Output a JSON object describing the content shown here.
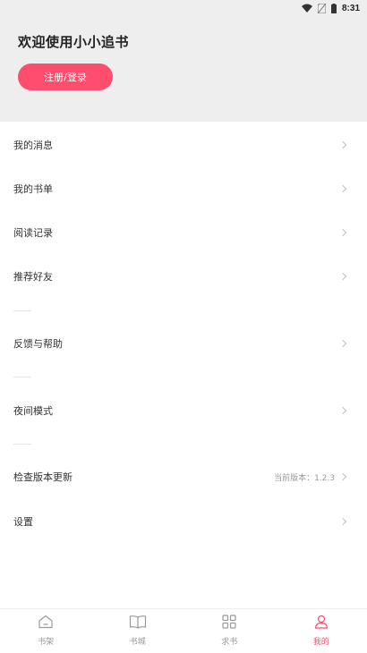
{
  "status_bar": {
    "time": "8:31",
    "icons": [
      "wifi-icon",
      "no-sim-icon",
      "battery-icon"
    ]
  },
  "header": {
    "welcome": "欢迎使用小小追书",
    "login_label": "注册/登录"
  },
  "menu": {
    "messages": "我的消息",
    "booklist": "我的书单",
    "history": "阅读记录",
    "recommend": "推荐好友",
    "feedback": "反馈与帮助",
    "night_mode": "夜间模式",
    "check_update": "检查版本更新",
    "current_version": "当前版本：1.2.3",
    "settings": "设置"
  },
  "tabbar": {
    "shelf": "书架",
    "store": "书城",
    "request": "求书",
    "mine": "我的"
  },
  "colors": {
    "accent": "#ff4d6d",
    "header_bg": "#eeeeee",
    "inactive": "#999999"
  }
}
